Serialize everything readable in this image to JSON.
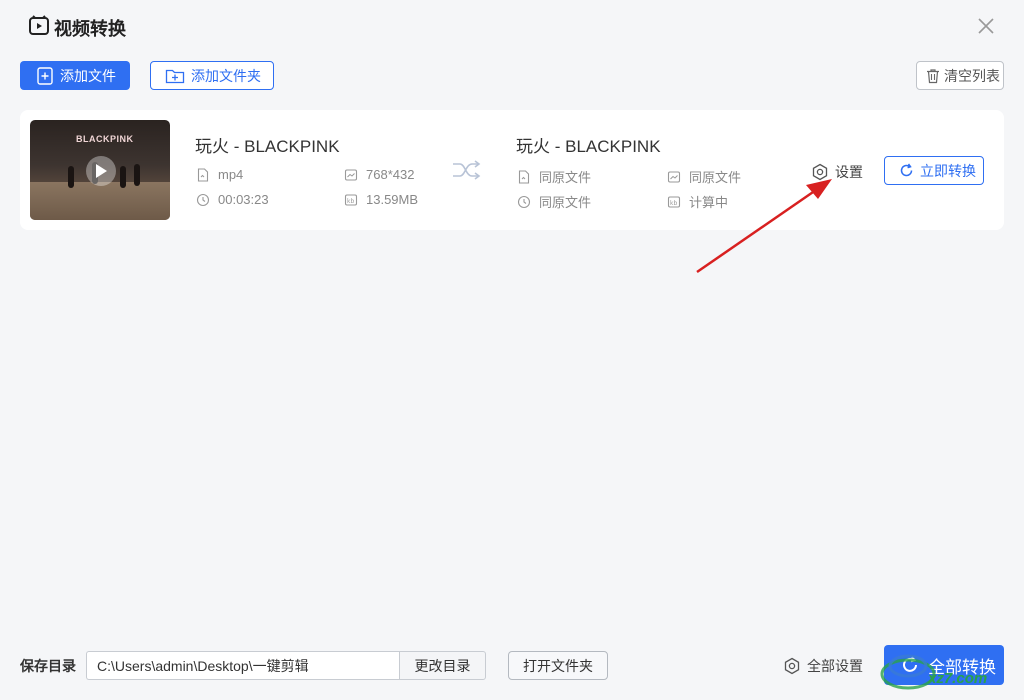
{
  "app": {
    "title": "视频转换",
    "icon": "video-convert-icon"
  },
  "toolbar": {
    "add_file_label": "添加文件",
    "add_folder_label": "添加文件夹",
    "clear_list_label": "清空列表"
  },
  "item": {
    "thumbnail_text": "BLACKPINK",
    "source": {
      "name": "玩火 - BLACKPINK",
      "format": "mp4",
      "resolution": "768*432",
      "duration": "00:03:23",
      "size": "13.59MB"
    },
    "target": {
      "name": "玩火 - BLACKPINK",
      "format": "同原文件",
      "resolution": "同原文件",
      "duration": "同原文件",
      "size": "计算中"
    },
    "settings_label": "设置",
    "convert_now_label": "立即转换"
  },
  "footer": {
    "save_dir_label": "保存目录",
    "save_dir_value": "C:\\Users\\admin\\Desktop\\一键剪辑",
    "change_dir_label": "更改目录",
    "open_folder_label": "打开文件夹",
    "all_settings_label": "全部设置",
    "convert_all_label": "全部转换"
  },
  "watermark": {
    "text": "xz7.com"
  },
  "colors": {
    "accent": "#2f6ff2",
    "annotation_arrow": "#d82020",
    "background": "#f5f6f8"
  }
}
